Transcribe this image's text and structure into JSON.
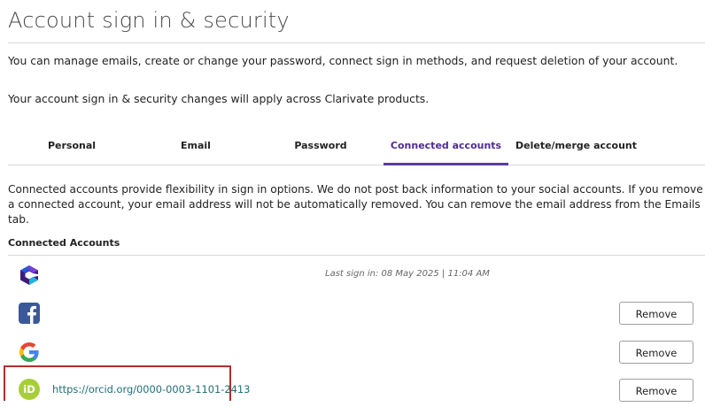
{
  "page": {
    "title": "Account sign in & security",
    "intro_line1": "You can manage emails, create or change your password, connect sign in methods, and request deletion of your account.",
    "intro_line2": "Your account sign in & security changes will apply across Clarivate products."
  },
  "tabs": [
    {
      "label": "Personal",
      "active": false
    },
    {
      "label": "Email",
      "active": false
    },
    {
      "label": "Password",
      "active": false
    },
    {
      "label": "Connected accounts",
      "active": true
    },
    {
      "label": "Delete/merge account",
      "active": false
    }
  ],
  "connected": {
    "description": "Connected accounts provide flexibility in sign in options. We do not post back information to your social accounts. If you remove a connected account, your email address will not be automatically removed. You can remove the email address from the Emails tab.",
    "heading": "Connected Accounts",
    "accounts": [
      {
        "icon": "clarivate-icon",
        "last_signin": "Last sign in: 08 May 2025 | 11:04 AM"
      },
      {
        "icon": "facebook-icon",
        "button_label": "Remove"
      },
      {
        "icon": "google-icon",
        "button_label": "Remove"
      },
      {
        "icon": "orcid-icon",
        "link": "https://orcid.org/0000-0003-1101-2413",
        "button_label": "Remove",
        "highlighted": true
      }
    ]
  },
  "colors": {
    "active_tab": "#5b3c9b",
    "facebook": "#3b5998",
    "orcid": "#a6ce39",
    "highlight_border": "#b32e2e",
    "link": "#1f6f75"
  }
}
